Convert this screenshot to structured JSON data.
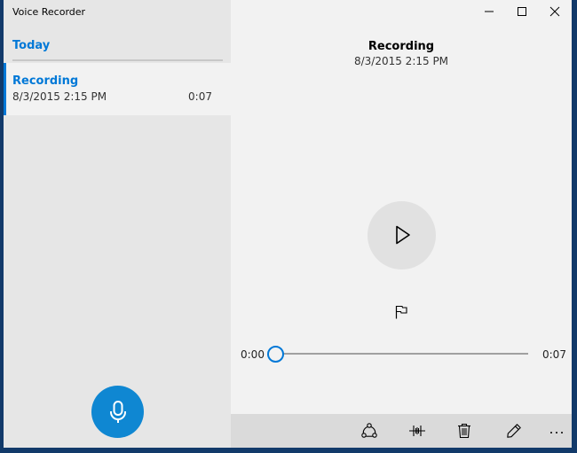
{
  "window": {
    "title": "Voice Recorder",
    "accent_color": "#0078d7",
    "record_button_color": "#0f87d2",
    "caption_buttons": [
      {
        "name": "minimize",
        "icon": "minimize-icon"
      },
      {
        "name": "maximize",
        "icon": "maximize-icon"
      },
      {
        "name": "close",
        "icon": "close-icon"
      }
    ]
  },
  "sidebar": {
    "group_header": "Today",
    "recordings": [
      {
        "title": "Recording",
        "date": "8/3/2015 2:15 PM",
        "duration": "0:07",
        "selected": true
      }
    ],
    "record_button": {
      "icon": "microphone-icon"
    }
  },
  "detail": {
    "title": "Recording",
    "date": "8/3/2015 2:15 PM",
    "play_button": {
      "icon": "play-icon"
    },
    "marker_button": {
      "icon": "flag-icon"
    },
    "playback": {
      "current_time": "0:00",
      "total_time": "0:07",
      "progress": 0
    }
  },
  "command_bar": {
    "items": [
      {
        "name": "share",
        "icon": "share-icon"
      },
      {
        "name": "trim",
        "icon": "trim-icon"
      },
      {
        "name": "delete",
        "icon": "trash-icon"
      },
      {
        "name": "rename",
        "icon": "pencil-icon"
      },
      {
        "name": "more",
        "icon": "more-icon"
      }
    ]
  }
}
